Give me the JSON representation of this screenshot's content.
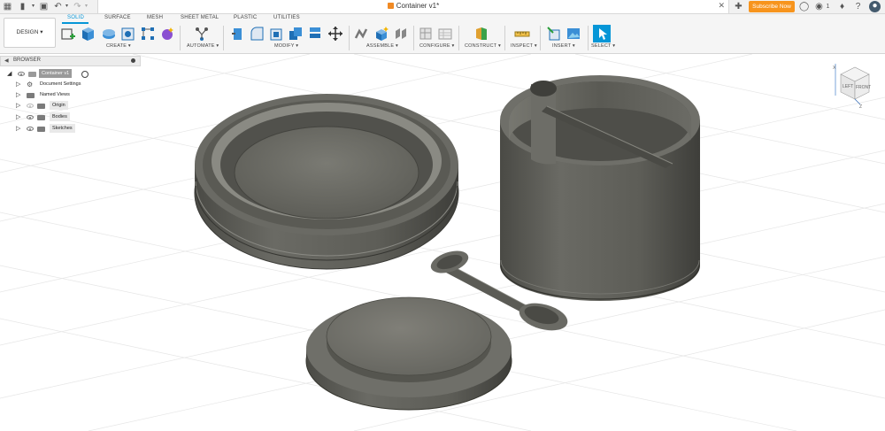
{
  "app": {
    "document_title": "Container v1*",
    "subscribe_label": "Subscribe Now",
    "notification_count": "1"
  },
  "workspace": {
    "mode_label": "DESIGN"
  },
  "tabs": [
    {
      "label": "SOLID",
      "active": true
    },
    {
      "label": "SURFACE",
      "active": false
    },
    {
      "label": "MESH",
      "active": false
    },
    {
      "label": "SHEET METAL",
      "active": false
    },
    {
      "label": "PLASTIC",
      "active": false
    },
    {
      "label": "UTILITIES",
      "active": false
    }
  ],
  "groups": {
    "create": "CREATE",
    "automate": "AUTOMATE",
    "modify": "MODIFY",
    "assemble": "ASSEMBLE",
    "configure": "CONFIGURE",
    "construct": "CONSTRUCT",
    "inspect": "INSPECT",
    "insert": "INSERT",
    "select": "SELECT"
  },
  "browser": {
    "title": "BROWSER",
    "root": "Container v1",
    "items": [
      {
        "label": "Document Settings",
        "icon": "gear-icon"
      },
      {
        "label": "Named Views",
        "icon": "folder-icon"
      },
      {
        "label": "Origin",
        "icon": "folder-icon"
      },
      {
        "label": "Bodies",
        "icon": "folder-icon"
      },
      {
        "label": "Sketches",
        "icon": "folder-icon"
      }
    ]
  },
  "viewcube": {
    "face_left": "LEFT",
    "face_front": "FRONT",
    "axis_z": "Z",
    "axis_x": "X"
  },
  "colors": {
    "accent": "#0696d7",
    "subscribe": "#f7941d",
    "body": "#5c5c56",
    "grid": "#e3e3e3"
  }
}
